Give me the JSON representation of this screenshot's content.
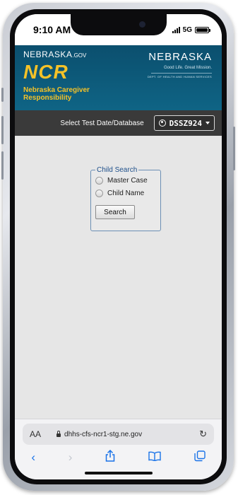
{
  "status": {
    "time": "9:10 AM",
    "network": "5G"
  },
  "banner": {
    "gov_label": "NEBRASKA",
    "gov_suffix": ".GOV",
    "app_short": "NCR",
    "app_full": "Nebraska Caregiver Responsibility",
    "state_title": "NEBRASKA",
    "motto": "Good Life. Great Mission.",
    "department": "DEPT. OF HEALTH AND HUMAN SERVICES"
  },
  "db_bar": {
    "label": "Select Test Date/Database",
    "selected": "DSSZ924"
  },
  "child_search": {
    "legend": "Child Search",
    "options": [
      "Master Case",
      "Child Name"
    ],
    "button_label": "Search"
  },
  "browser": {
    "aa_label": "AA",
    "url": "dhhs-cfs-ncr1-stg.ne.gov"
  },
  "icons": {
    "reload": "reload-icon",
    "back": "back-icon",
    "forward": "forward-icon",
    "share": "share-icon",
    "bookmarks": "bookmarks-icon",
    "tabs": "tabs-icon"
  },
  "colors": {
    "banner": "#0f6485",
    "accent": "#f5c228",
    "link": "#1a73e8"
  }
}
